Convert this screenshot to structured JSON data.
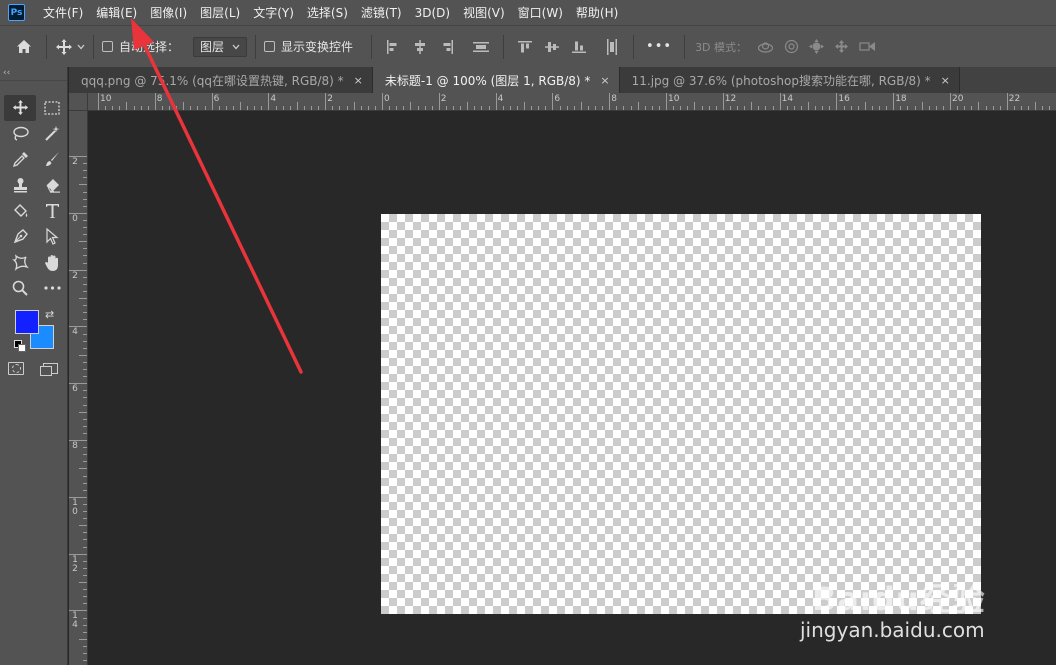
{
  "app": {
    "logo": "Ps"
  },
  "menu": [
    "文件(F)",
    "编辑(E)",
    "图像(I)",
    "图层(L)",
    "文字(Y)",
    "选择(S)",
    "滤镜(T)",
    "3D(D)",
    "视图(V)",
    "窗口(W)",
    "帮助(H)"
  ],
  "options": {
    "auto_select_label": "自动选择：",
    "auto_select_target": "图层",
    "show_transform_label": "显示变换控件",
    "more_label": "•••",
    "mode_3d_label": "3D 模式："
  },
  "tabs": [
    {
      "label": "qqq.png @ 75.1% (qq在哪设置热键, RGB/8) *",
      "close": "×",
      "active": false
    },
    {
      "label": "未标题-1 @ 100% (图层 1, RGB/8) *",
      "close": "×",
      "active": true
    },
    {
      "label": "11.jpg @ 37.6% (photoshop搜索功能在哪, RGB/8) *",
      "close": "×",
      "active": false
    }
  ],
  "ruler_top_labels": [
    "10",
    "8",
    "6",
    "4",
    "2",
    "0",
    "2",
    "4",
    "6",
    "8",
    "10",
    "12",
    "14",
    "16",
    "18",
    "20",
    "22"
  ],
  "ruler_left_labels": [
    "2",
    "0",
    "2",
    "4",
    "6",
    "8",
    "10",
    "12",
    "14"
  ],
  "colors": {
    "foreground": "#1320ff",
    "background": "#1a8cff",
    "annotation_arrow": "#e8343a"
  },
  "watermark": {
    "logo": "Baidu经验",
    "url": "jingyan.baidu.com"
  }
}
